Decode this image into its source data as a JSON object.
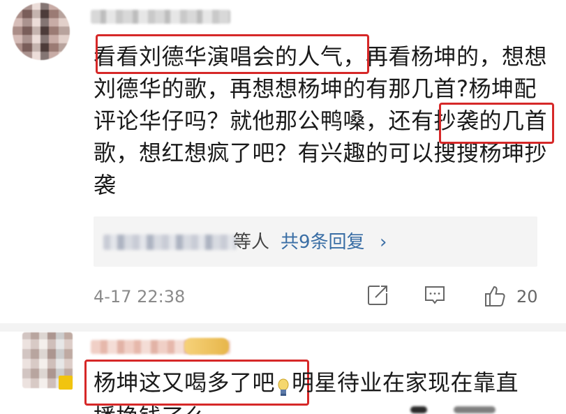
{
  "comment1": {
    "text": "看看刘德华演唱会的人气，再看杨坤的，想想刘德华的歌，再想想杨坤的有那几首?杨坤配评论华仔吗？就他那公鸭嗓，还有抄袭的几首歌，想红想疯了吧？有兴趣的可以搜搜杨坤抄袭",
    "highlights": [
      "看看刘德华演唱会的人气",
      "还有抄袭"
    ],
    "reply_suffix": "等人",
    "reply_link": "共9条回复",
    "reply_chevron": "›",
    "time": "4-17 22:38",
    "like_count": "20"
  },
  "comment2": {
    "highlight_text": "杨坤这又喝多了吧",
    "rest_text": "明星待业在家现在靠直",
    "line2_partial": "播挣钱了么"
  },
  "colors": {
    "highlight_border": "#d62828",
    "link": "#3a6ea5",
    "meta": "#8a8a8a",
    "reply_bg": "#f4f4f4"
  },
  "icons": {
    "share": "share-icon",
    "comment": "comment-icon",
    "like": "thumbs-up-icon",
    "emoji": "lightbulb-emoji-icon"
  }
}
